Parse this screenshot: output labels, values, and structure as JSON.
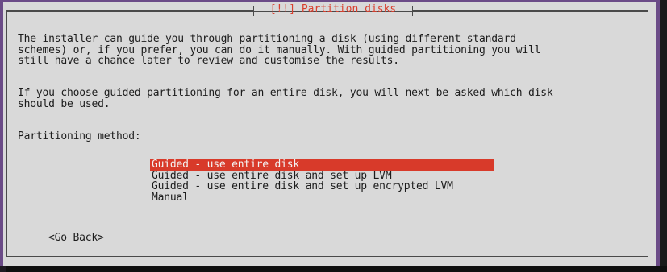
{
  "dialog": {
    "title": "[!!] Partition disks",
    "intro_paragraph": "The installer can guide you through partitioning a disk (using different standard\nschemes) or, if you prefer, you can do it manually. With guided partitioning you will\nstill have a chance later to review and customise the results.",
    "guided_paragraph": "If you choose guided partitioning for an entire disk, you will next be asked which disk\nshould be used.",
    "method_label": "Partitioning method:",
    "options": [
      {
        "label": "Guided - use entire disk",
        "selected": true
      },
      {
        "label": "Guided - use entire disk and set up LVM",
        "selected": false
      },
      {
        "label": "Guided - use entire disk and set up encrypted LVM",
        "selected": false
      },
      {
        "label": "Manual",
        "selected": false
      }
    ],
    "back_button": "<Go Back>"
  },
  "colors": {
    "dialog_background": "#d9d9d9",
    "window_border": "#6b4b87",
    "selection": "#d83a2a",
    "title_text": "#d93f2e"
  }
}
